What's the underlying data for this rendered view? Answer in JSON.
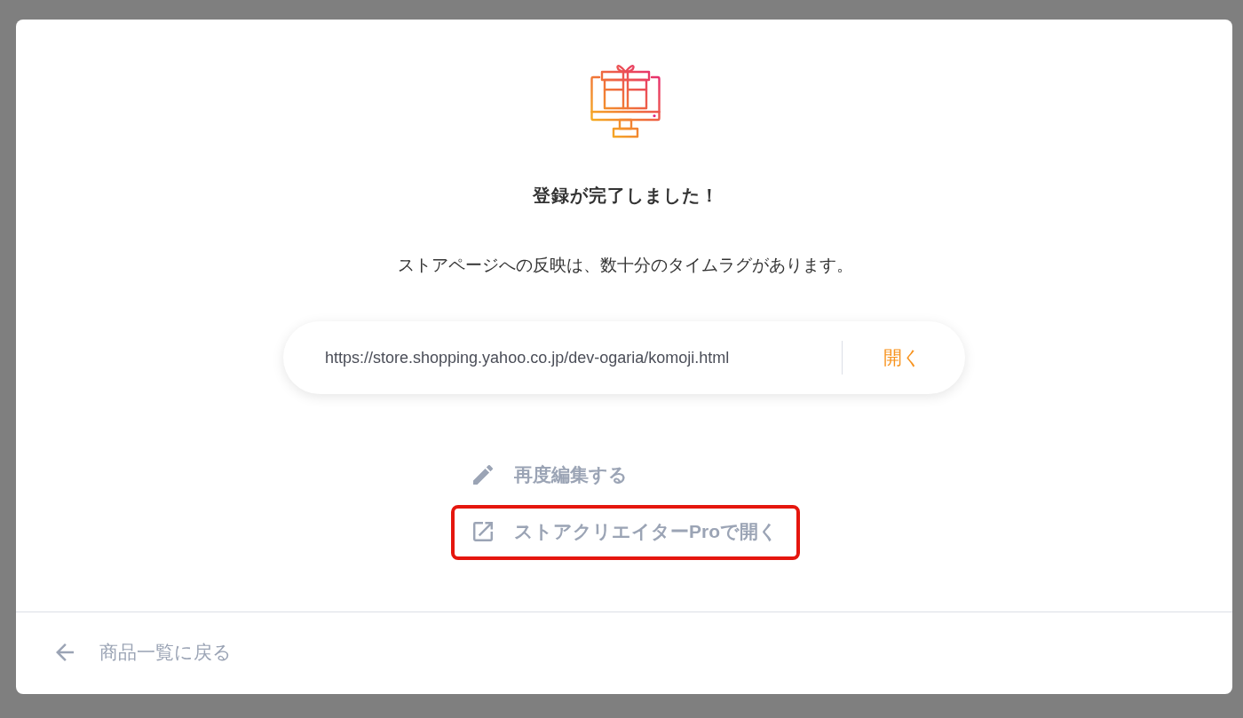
{
  "dialog": {
    "title": "登録が完了しました！",
    "message": "ストアページへの反映は、数十分のタイムラグがあります。",
    "url_bar": {
      "value": "https://store.shopping.yahoo.co.jp/dev-ogaria/komoji.html",
      "button": "開く"
    },
    "actions": [
      {
        "kind": "edit",
        "label": "再度編集する",
        "highlighted": false
      },
      {
        "kind": "external",
        "label": "ストアクリエイターProで開く",
        "highlighted": true
      }
    ],
    "footer": {
      "back_link": "商品一覧に戻る"
    }
  }
}
